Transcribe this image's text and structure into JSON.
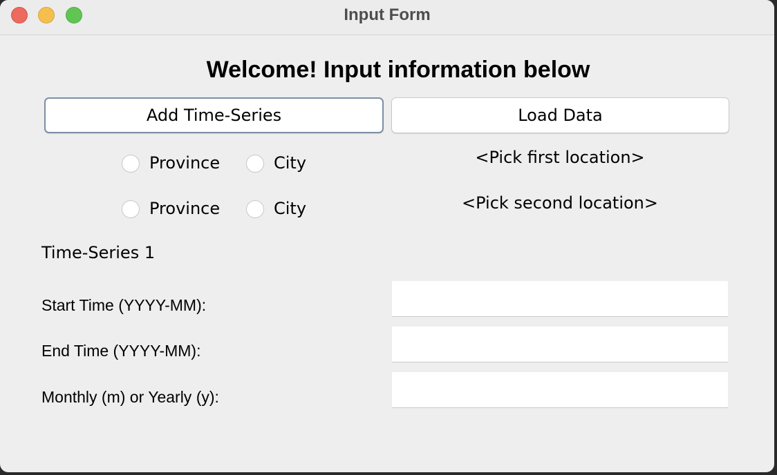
{
  "window": {
    "title": "Input Form"
  },
  "heading": "Welcome! Input information below",
  "buttons": {
    "add_time_series": "Add Time-Series",
    "load_data": "Load Data"
  },
  "location_rows": [
    {
      "option_province": "Province",
      "option_city": "City",
      "selected": null,
      "location_label": "<Pick first location>"
    },
    {
      "option_province": "Province",
      "option_city": "City",
      "selected": null,
      "location_label": "<Pick second location>"
    }
  ],
  "time_series": {
    "title": "Time-Series 1",
    "fields": [
      {
        "label": "Start Time (YYYY-MM):",
        "value": ""
      },
      {
        "label": "End Time (YYYY-MM):",
        "value": ""
      },
      {
        "label": "Monthly (m) or Yearly (y):",
        "value": ""
      }
    ]
  },
  "colors": {
    "window_bg": "#eeeeee",
    "close": "#ed6a5e",
    "minimize": "#f5bf4f",
    "zoom": "#61c554",
    "focus_ring": "#7e8fa6"
  }
}
